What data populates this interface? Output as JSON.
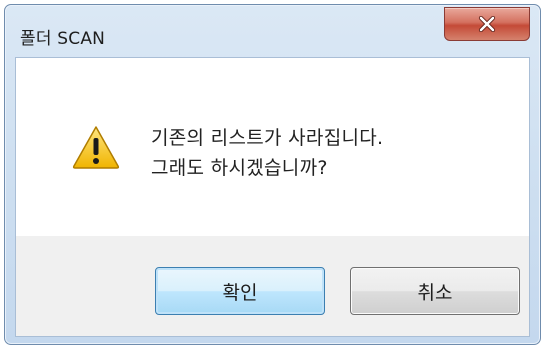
{
  "window": {
    "title": "폴더 SCAN"
  },
  "icons": {
    "close": "close-icon",
    "warning": "warning-icon"
  },
  "message": {
    "line1": "기존의 리스트가 사라집니다.",
    "line2": "그래도 하시겠습니까?"
  },
  "buttons": {
    "ok_label": "확인",
    "cancel_label": "취소"
  },
  "colors": {
    "close_button": "#c44a37",
    "warning": "#f5c518",
    "ok_button_border": "#3c7fb1"
  }
}
